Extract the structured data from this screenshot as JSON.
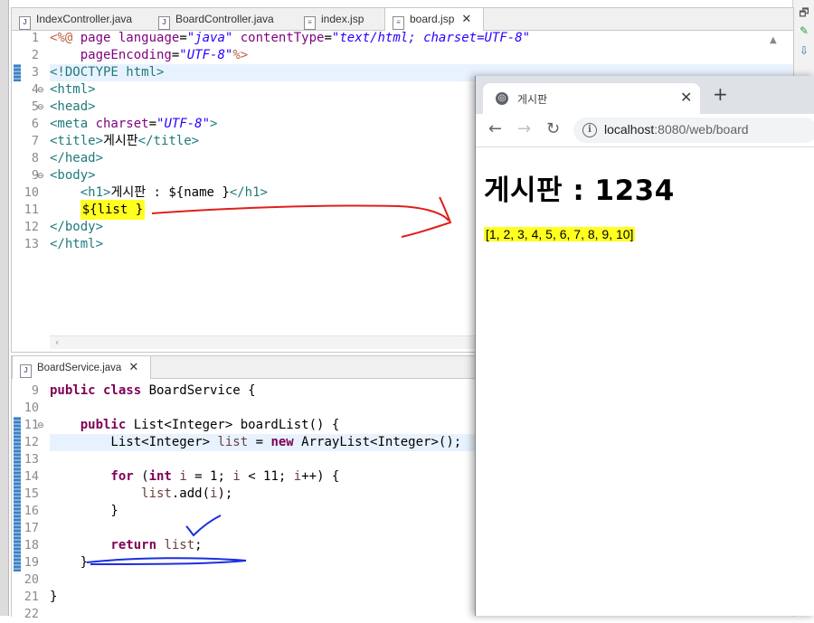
{
  "top_editor": {
    "tabs": [
      {
        "label": "IndexController.java"
      },
      {
        "label": "BoardController.java"
      },
      {
        "label": "index.jsp"
      },
      {
        "label": "board.jsp",
        "close": "✕"
      }
    ],
    "line_numbers": [
      "1",
      "2",
      "3",
      "4",
      "5",
      "6",
      "7",
      "8",
      "9",
      "10",
      "11",
      "12",
      "13"
    ],
    "code": {
      "l1": {
        "a": "<%@ ",
        "b": "page ",
        "c": "language",
        "d": "=",
        "e": "\"java\"",
        "f": " contentType",
        "g": "=",
        "h": "\"text/html; charset=UTF-8\""
      },
      "l2": {
        "a": "    pageEncoding",
        "b": "=",
        "c": "\"UTF-8\"",
        "d": "%>"
      },
      "l3": "<!DOCTYPE html>",
      "l4": "<html>",
      "l5": "<head>",
      "l6": {
        "a": "<meta ",
        "b": "charset",
        "c": "=",
        "d": "\"UTF-8\"",
        "e": ">"
      },
      "l7": {
        "a": "<title>",
        "b": "게시판",
        "c": "</title>"
      },
      "l8": "</head>",
      "l9": "<body>",
      "l10": {
        "a": "    ",
        "b": "<h1>",
        "c": "게시판 : ${name }",
        "d": "</h1>"
      },
      "l11": "${list }",
      "l12": "</body>",
      "l13": "</html>"
    }
  },
  "bottom_editor": {
    "tab": {
      "label": "BoardService.java",
      "close": "✕"
    },
    "line_numbers": [
      "9",
      "10",
      "11",
      "12",
      "13",
      "14",
      "15",
      "16",
      "17",
      "18",
      "19",
      "20",
      "21",
      "22"
    ],
    "code": {
      "l9": {
        "a": "public class ",
        "b": "BoardService {"
      },
      "l11": {
        "a": "    public ",
        "b": "List<Integer> boardList() {"
      },
      "l12": {
        "a": "        List<Integer> ",
        "b": "list",
        "c": " = ",
        "d": "new",
        "e": " ArrayList<Integer>();"
      },
      "l14": {
        "a": "        for",
        "b": " (",
        "c": "int",
        "d": " ",
        "e": "i",
        "f": " = 1; ",
        "g": "i",
        "h": " < 11; ",
        "i": "i",
        "j": "++) {"
      },
      "l15": {
        "a": "            ",
        "b": "list",
        "c": ".add(",
        "d": "i",
        "e": ");"
      },
      "l16": "        }",
      "l18": {
        "a": "        return ",
        "b": "list",
        "c": ";"
      },
      "l19": "    }",
      "l21": "}"
    }
  },
  "browser": {
    "tab_title": "게시판",
    "tab_close": "✕",
    "new_tab": "+",
    "url_host": "localhost",
    "url_rest": ":8080/web/board",
    "heading": "게시판 : 1234",
    "list_output": "[1, 2, 3, 4, 5, 6, 7, 8, 9, 10]"
  },
  "icons": {
    "globe": "globe-icon",
    "back": "arrow-left-icon",
    "forward": "arrow-right-icon",
    "reload": "reload-icon",
    "info": "info-icon"
  },
  "colors": {
    "highlight": "#ffff20",
    "annotation_red": "#e0201c",
    "annotation_blue": "#1a2fe0"
  }
}
